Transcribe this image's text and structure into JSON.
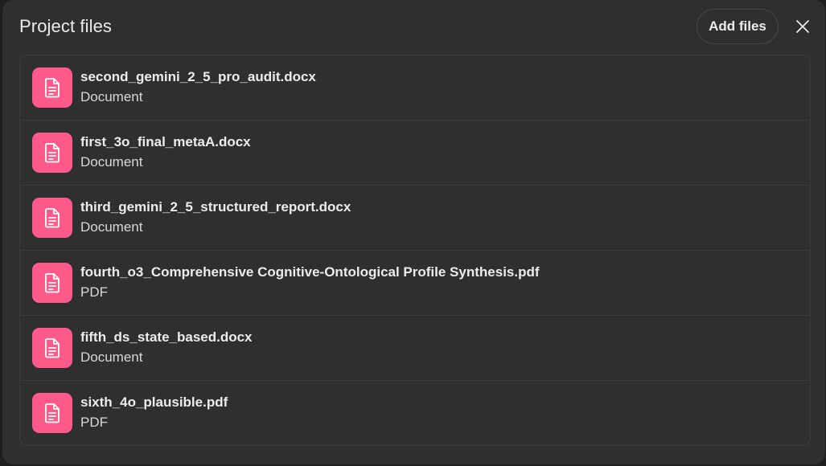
{
  "header": {
    "title": "Project files",
    "add_files_label": "Add files",
    "close_icon": "close-icon"
  },
  "files": [
    {
      "name": "second_gemini_2_5_pro_audit.docx",
      "type": "Document",
      "icon": "document-icon"
    },
    {
      "name": "first_3o_final_metaA.docx",
      "type": "Document",
      "icon": "document-icon"
    },
    {
      "name": "third_gemini_2_5_structured_report.docx",
      "type": "Document",
      "icon": "document-icon"
    },
    {
      "name": "fourth_o3_Comprehensive Cognitive-Ontological Profile Synthesis.pdf",
      "type": "PDF",
      "icon": "document-icon"
    },
    {
      "name": "fifth_ds_state_based.docx",
      "type": "Document",
      "icon": "document-icon"
    },
    {
      "name": "sixth_4o_plausible.pdf",
      "type": "PDF",
      "icon": "document-icon"
    }
  ],
  "colors": {
    "icon_bg": "#ff5a8a",
    "panel_bg": "#2f2f2f"
  }
}
